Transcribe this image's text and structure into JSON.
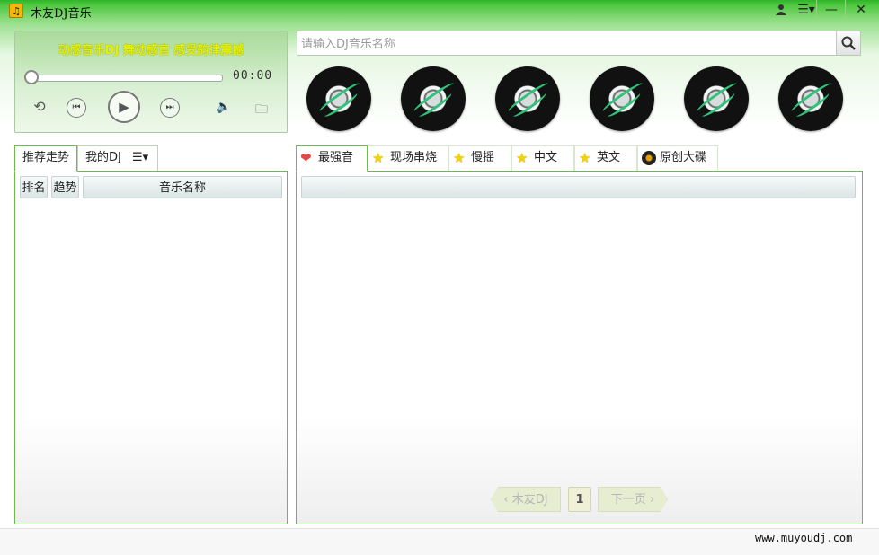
{
  "window": {
    "icon_glyph": "♫",
    "title": "木友DJ音乐",
    "user_icon": "user-icon",
    "menu_glyph": "☰▾",
    "minimize_glyph": "—",
    "close_glyph": "✕"
  },
  "player": {
    "slogan": "动感音乐DJ 舞动感官 感受韵律震撼",
    "time": "00:00",
    "progress_fraction": 0.0,
    "glyphs": {
      "loop": "⟲",
      "prev": "⏮",
      "play": "▶",
      "next": "⏭",
      "volume": "🔈",
      "folder": "🗀"
    }
  },
  "search": {
    "placeholder": "请输入DJ音乐名称",
    "value": "",
    "button_glyph": "🔍"
  },
  "left_tabs": {
    "recommend": "推荐走势",
    "my_dj": "我的DJ",
    "menu_glyph": "☰▾"
  },
  "left_table": {
    "columns": [
      "排名",
      "趋势",
      "音乐名称"
    ],
    "rows": []
  },
  "right_tabs": [
    {
      "label": "最强音",
      "icon": "heart-icon",
      "glyph": "❤"
    },
    {
      "label": "现场串烧",
      "icon": "star-icon",
      "glyph": "★"
    },
    {
      "label": "慢摇",
      "icon": "star-icon",
      "glyph": "★"
    },
    {
      "label": "中文",
      "icon": "star-icon",
      "glyph": "★"
    },
    {
      "label": "英文",
      "icon": "star-icon",
      "glyph": "★"
    },
    {
      "label": "原创大碟",
      "icon": "cd-icon",
      "glyph": ""
    }
  ],
  "pagination": {
    "prev_label": "‹ 木友DJ",
    "current_page": "1",
    "next_label": "下一页 ›"
  },
  "footer": {
    "site": "www.muyoudj.com"
  },
  "colors": {
    "accent_green": "#4fc940",
    "panel_border": "#6cba4c",
    "slogan_yellow": "#e8f000"
  }
}
